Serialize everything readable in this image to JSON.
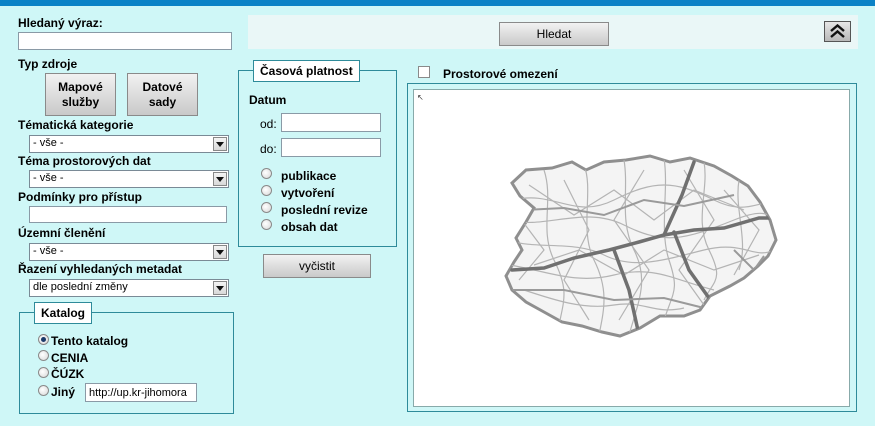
{
  "search": {
    "label": "Hledaný výraz:",
    "value": "",
    "button": "Hledat"
  },
  "source_type": {
    "label": "Typ zdroje",
    "buttons": [
      "Mapové služby",
      "Datové sady"
    ]
  },
  "thematic_category": {
    "label": "Tématická kategorie",
    "selected": "- vše -"
  },
  "spatial_topic": {
    "label": "Téma prostorových dat",
    "selected": "- vše -"
  },
  "access_conditions": {
    "label": "Podmínky pro přístup",
    "value": ""
  },
  "territorial_division": {
    "label": "Územní členění",
    "selected": "- vše -"
  },
  "sorting": {
    "label": "Řazení vyhledaných metadat",
    "selected": "dle poslední změny"
  },
  "catalog": {
    "legend": "Katalog",
    "options": [
      "Tento katalog",
      "CENIA",
      "ČÚZK",
      "Jiný"
    ],
    "selected_index": 0,
    "other_url": "http://up.kr-jihomora"
  },
  "temporal": {
    "legend": "Časová platnost",
    "date_label": "Datum",
    "from_label": "od:",
    "to_label": "do:",
    "from_value": "",
    "to_value": "",
    "options": [
      "publikace",
      "vytvoření",
      "poslední revize",
      "obsah dat"
    ],
    "clear_button": "vyčistit"
  },
  "spatial_restriction": {
    "label": "Prostorové omezení",
    "checked": false
  },
  "icons": {
    "collapse": "double-chevron-up-icon",
    "map": "region-roads-map"
  },
  "colors": {
    "top_bar": "#0a82c6",
    "background": "#cff7f7",
    "border": "#2e8b9a"
  }
}
